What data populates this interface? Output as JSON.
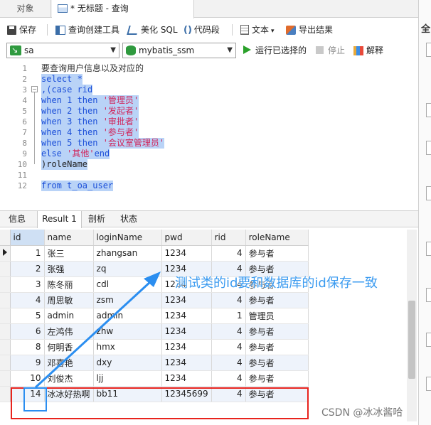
{
  "tabs": {
    "objects": "对象",
    "query": "* 无标题 - 查询"
  },
  "toolbar": {
    "save": "保存",
    "query_builder": "查询创建工具",
    "beautify_sql": "美化 SQL",
    "snippet_icon": "()",
    "snippet": "代码段",
    "text": "文本",
    "export": "导出结果"
  },
  "connection": {
    "connection_name": "sa",
    "database_name": "mybatis_ssm",
    "run_selected": "运行已选择的",
    "stop": "停止",
    "explain": "解释"
  },
  "editor": {
    "lines": [
      {
        "n": "1",
        "text": "要查询用户信息以及对应的"
      },
      {
        "n": "2",
        "text": "select *"
      },
      {
        "n": "3",
        "text": ",(case rid"
      },
      {
        "n": "4",
        "text": "when 1 then '管理员'"
      },
      {
        "n": "5",
        "text": "when 2 then '发起者'"
      },
      {
        "n": "6",
        "text": "when 3 then '审批者'"
      },
      {
        "n": "7",
        "text": "when 4 then '参与者'"
      },
      {
        "n": "8",
        "text": "when 5 then '会议室管理员'"
      },
      {
        "n": "9",
        "text": "else '其他'end"
      },
      {
        "n": "10",
        "text": ")roleName"
      },
      {
        "n": "11",
        "text": ""
      },
      {
        "n": "12",
        "text": "from t_oa_user"
      }
    ]
  },
  "result_tabs": {
    "info": "信息",
    "result1": "Result 1",
    "profile": "剖析",
    "status": "状态"
  },
  "grid": {
    "columns": [
      "id",
      "name",
      "loginName",
      "pwd",
      "rid",
      "roleName"
    ],
    "rows": [
      [
        "1",
        "张三",
        "zhangsan",
        "1234",
        "4",
        "参与者"
      ],
      [
        "2",
        "张强",
        "zq",
        "1234",
        "4",
        "参与者"
      ],
      [
        "3",
        "陈冬丽",
        "cdl",
        "1234",
        "4",
        "参与者"
      ],
      [
        "4",
        "周思敏",
        "zsm",
        "1234",
        "4",
        "参与者"
      ],
      [
        "5",
        "admin",
        "admin",
        "1234",
        "1",
        "管理员"
      ],
      [
        "6",
        "左鸿伟",
        "zhw",
        "1234",
        "4",
        "参与者"
      ],
      [
        "8",
        "何明香",
        "hmx",
        "1234",
        "4",
        "参与者"
      ],
      [
        "9",
        "邓喜艳",
        "dxy",
        "1234",
        "4",
        "参与者"
      ],
      [
        "10",
        "刘俊杰",
        "ljj",
        "1234",
        "4",
        "参与者"
      ],
      [
        "14",
        "冰冰好热啊",
        "bb11",
        "12345699",
        "4",
        "参与者"
      ]
    ]
  },
  "right_panel": {
    "label": "全"
  },
  "annotation": {
    "text": "测试类的id要和数据库的id保存一致"
  },
  "watermark": "CSDN @冰冰酱哈",
  "colors": {
    "annotation_blue": "#3b9bf0",
    "highlight_red": "#e8231d",
    "selection": "#b9d3f7",
    "keyword": "#1c4fd8",
    "string": "#d0245a"
  }
}
